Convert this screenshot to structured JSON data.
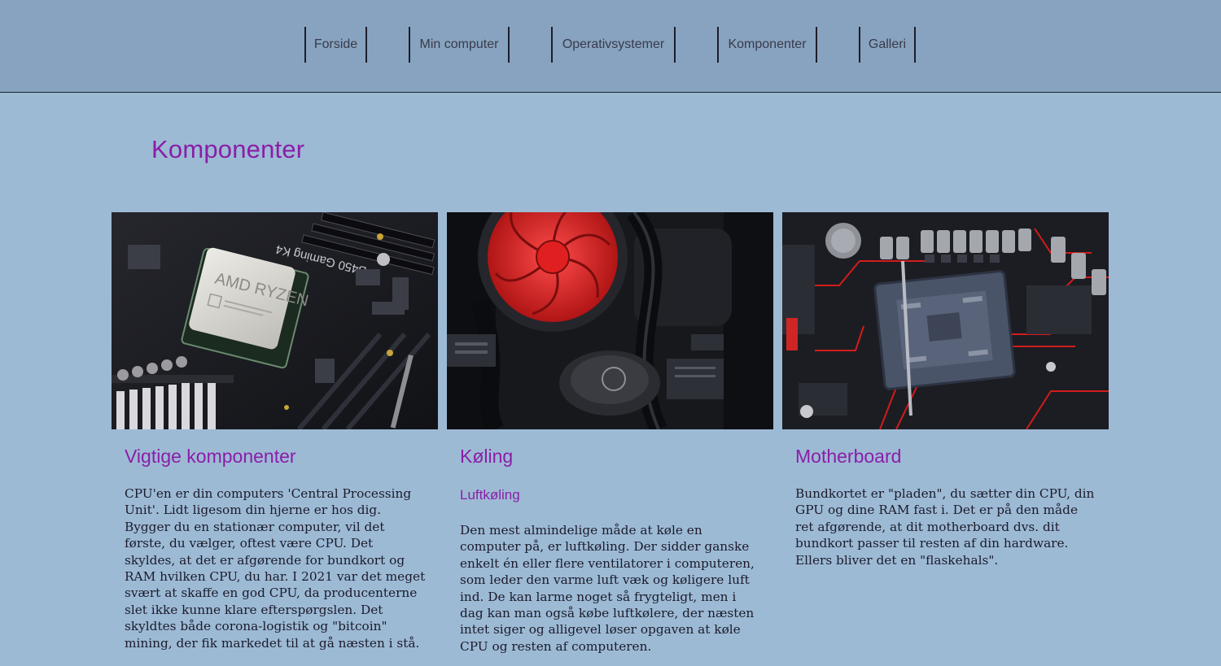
{
  "nav": {
    "items": [
      {
        "label": "Forside"
      },
      {
        "label": "Min computer"
      },
      {
        "label": "Operativsystemer"
      },
      {
        "label": "Komponenter"
      },
      {
        "label": "Galleri"
      }
    ]
  },
  "page": {
    "title": "Komponenter"
  },
  "cards": [
    {
      "title": "Vigtige komponenter",
      "text": "CPU'en er din computers 'Central Processing Unit'. Lidt ligesom din hjerne er hos dig. Bygger du en stationær computer, vil det første, du vælger, oftest være CPU. Det skyldes, at det er afgørende for bundkort og RAM hvilken CPU, du har. I 2021 var det meget svært at skaffe en god CPU, da producenterne slet ikke kunne klare efterspørgslen. Det skyldtes både corona-logistik og \"bitcoin\" mining, der fik markedet til at gå næsten i stå.",
      "image_label": "AMD RYZEN",
      "board_label": "B450 Gaming K4"
    },
    {
      "title": "Køling",
      "subtitle": "Luftkøling",
      "text": "Den mest almindelige måde at køle en computer på, er luftkøling. Der sidder ganske enkelt én eller flere ventilatorer i computeren, som leder den varme luft væk og køligere luft ind. De kan larme noget så frygteligt, men i dag kan man også købe luftkølere, der næsten intet siger og alligevel løser opgaven at køle CPU og resten af computeren."
    },
    {
      "title": "Motherboard",
      "text": "Bundkortet er \"pladen\", du sætter din CPU, din GPU og dine RAM fast i. Det er på den måde ret afgørende, at dit motherboard dvs. dit bundkort passer til resten af din hardware. Ellers bliver det en \"flaskehals\"."
    }
  ],
  "colors": {
    "background": "#9dbad5",
    "header": "#87a3bf",
    "accent": "#8a1ea8",
    "text": "#1b1b2a"
  }
}
